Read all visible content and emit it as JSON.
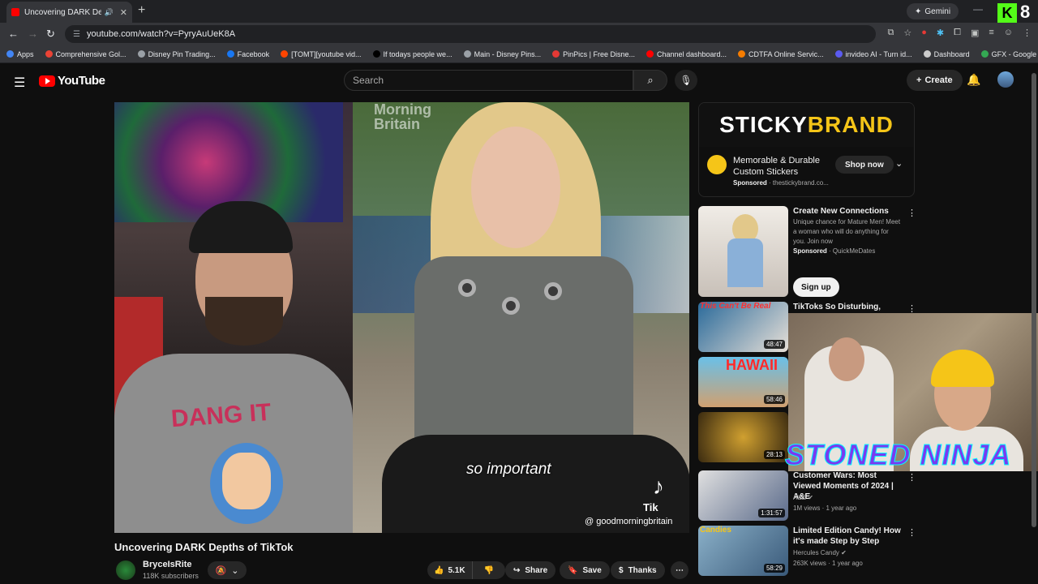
{
  "browser": {
    "tab_title": "Uncovering DARK Depths o",
    "gemini_label": "Gemini",
    "url": "youtube.com/watch?v=PyryAuUeK8A",
    "bookmarks": [
      {
        "label": "Apps",
        "color": "#4285f4"
      },
      {
        "label": "Comprehensive Gol...",
        "color": "#ea4335"
      },
      {
        "label": "Disney Pin Trading...",
        "color": "#9aa0a6"
      },
      {
        "label": "Facebook",
        "color": "#1877f2"
      },
      {
        "label": "[TOMT][youtube vid...",
        "color": "#ff4500"
      },
      {
        "label": "If todays people we...",
        "color": "#000000"
      },
      {
        "label": "Main - Disney Pins...",
        "color": "#9aa0a6"
      },
      {
        "label": "PinPics | Free Disne...",
        "color": "#e53935"
      },
      {
        "label": "Channel dashboard...",
        "color": "#ff0000"
      },
      {
        "label": "CDTFA Online Servic...",
        "color": "#f57c00"
      },
      {
        "label": "invideo AI - Turn id...",
        "color": "#5b5bf0"
      },
      {
        "label": "Dashboard",
        "color": "#cccccc"
      },
      {
        "label": "GFX - Google Drive",
        "color": "#34a853"
      }
    ],
    "k_badge": "K",
    "k_count": "8"
  },
  "youtube": {
    "logo_text": "YouTube",
    "search_placeholder": "Search",
    "create_label": "Create"
  },
  "video": {
    "caption": "so important",
    "tiktok_word": "Tik",
    "handle": "@ goodmorningbritain",
    "watermark": "Morning\nBritain",
    "shirt_text": "DANG IT",
    "title": "Uncovering DARK Depths of TikTok",
    "channel": "BryceIsRite",
    "subscribers": "118K subscribers",
    "likes": "5.1K",
    "share_label": "Share",
    "save_label": "Save",
    "thanks_label": "Thanks"
  },
  "ad": {
    "brand_white": "STICKY ",
    "brand_yellow": "BRAND",
    "title": "Memorable & Durable Custom Stickers",
    "sponsored": "Sponsored",
    "domain": "thestickybrand.co...",
    "cta": "Shop now"
  },
  "sidebar": [
    {
      "title": "Create New Connections",
      "desc": "Unique chance for Mature Men! Meet a woman who will do anything for you. Join now",
      "sponsored": "Sponsored",
      "advertiser": "QuickMeDates",
      "cta": "Sign up"
    },
    {
      "title": "TikToks So Disturbing, You'll",
      "thumb_text": "This Can't Be Real",
      "duration": "48:47"
    },
    {
      "thumb_text": "HAWAII",
      "duration": "58:46"
    },
    {
      "duration": "28:13"
    },
    {
      "title": "Customer Wars: Most Viewed Moments of 2024 | A&E",
      "channel": "A&E",
      "views": "1M views",
      "age": "1 year ago",
      "duration": "1:31:57"
    },
    {
      "title": "Limited Edition Candy! How it's made Step by Step",
      "channel": "Hercules Candy",
      "views": "263K views",
      "age": "1 year ago",
      "thumb_text": "Candies",
      "duration": "58:29"
    }
  ],
  "overlay": {
    "name": "STONED NINJA"
  }
}
